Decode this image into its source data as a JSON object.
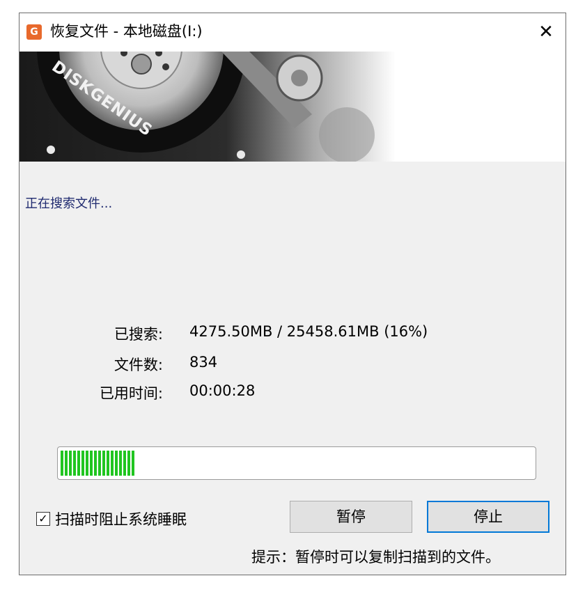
{
  "window": {
    "title": "恢复文件 - 本地磁盘(I:)",
    "app_icon_glyph": "G",
    "close_glyph": "✕"
  },
  "banner": {
    "logo_text": "DISKGENIUS"
  },
  "status": "正在搜索文件...",
  "stats": {
    "searched_label": "已搜索:",
    "searched_value": "4275.50MB / 25458.61MB (16%)",
    "files_label": "文件数:",
    "files_value": "834",
    "elapsed_label": "已用时间:",
    "elapsed_value": "00:00:28"
  },
  "progress": {
    "fraction": 0.16,
    "color": "#20c520"
  },
  "options": {
    "prevent_sleep_label": "扫描时阻止系统睡眠",
    "prevent_sleep_checked": true,
    "checkbox_glyph": "✓"
  },
  "buttons": {
    "pause": "暂停",
    "stop": "停止"
  },
  "hint": "提示：暂停时可以复制扫描到的文件。"
}
